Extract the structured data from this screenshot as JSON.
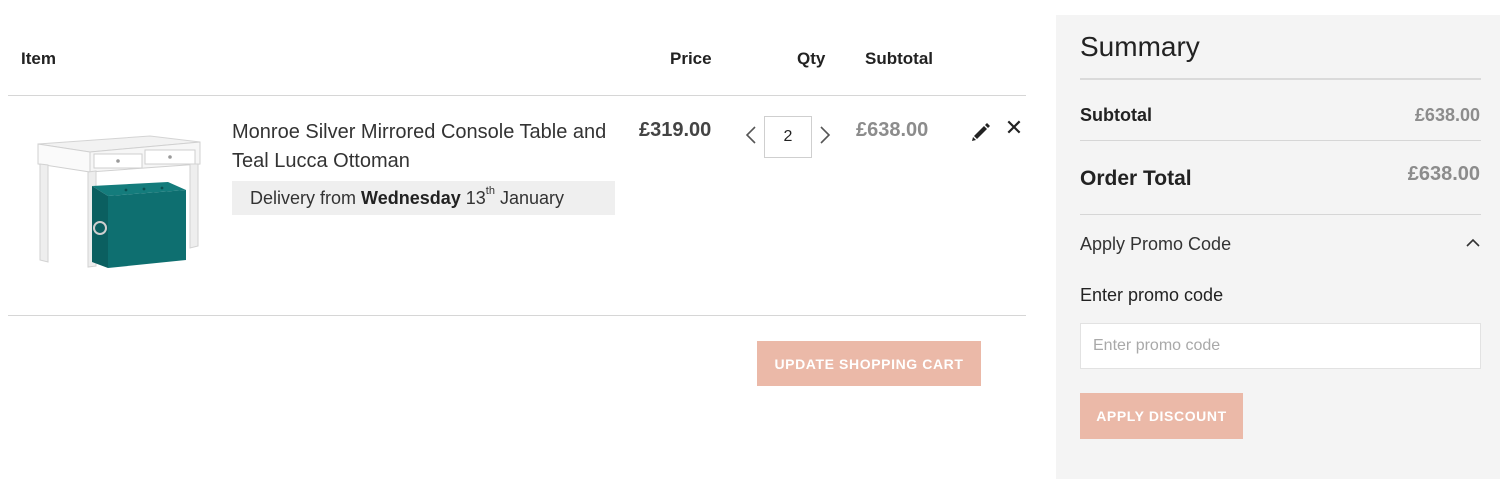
{
  "cart": {
    "headers": {
      "item": "Item",
      "price": "Price",
      "qty": "Qty",
      "subtotal": "Subtotal"
    },
    "items": [
      {
        "name": "Monroe Silver Mirrored Console Table and Teal Lucca Ottoman",
        "delivery_prefix": "Delivery from",
        "delivery_day": "Wednesday",
        "delivery_date": "13",
        "delivery_suffix": "th",
        "delivery_month": "January",
        "price": "£319.00",
        "qty": "2",
        "subtotal": "£638.00",
        "image_icon": "console-table-ottoman-image"
      }
    ],
    "update_button": "UPDATE SHOPPING CART",
    "icons": {
      "prev": "chevron-left-icon",
      "next": "chevron-right-icon",
      "edit": "pencil-icon",
      "remove": "close-icon"
    }
  },
  "summary": {
    "title": "Summary",
    "subtotal_label": "Subtotal",
    "subtotal_value": "£638.00",
    "total_label": "Order Total",
    "total_value": "£638.00",
    "promo_toggle_label": "Apply Promo Code",
    "promo_field_label": "Enter promo code",
    "promo_placeholder": "Enter promo code",
    "promo_value": "",
    "apply_button": "APPLY DISCOUNT"
  },
  "colors": {
    "accent_button": "#ebb9a8",
    "summary_bg": "#f4f4f4",
    "muted_price": "#8c8c8c",
    "ottoman_teal": "#0e6f70"
  }
}
